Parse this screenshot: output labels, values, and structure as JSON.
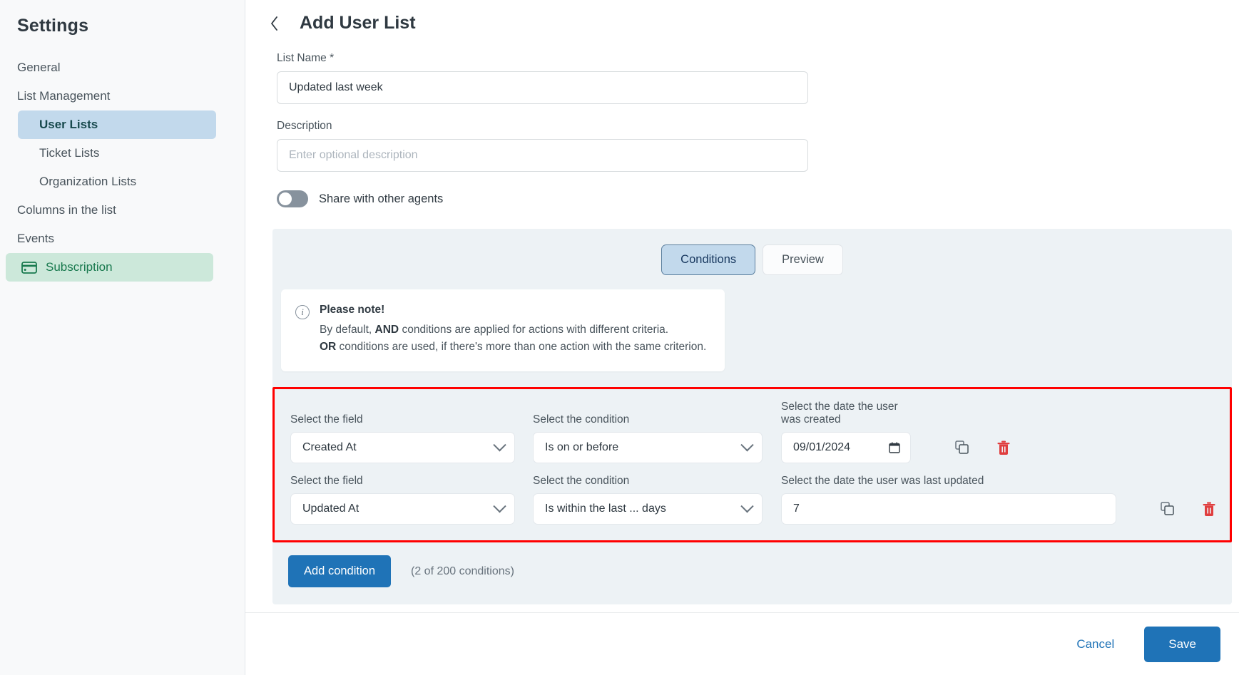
{
  "sidebar": {
    "title": "Settings",
    "items": [
      {
        "label": "General",
        "level": "top"
      },
      {
        "label": "List Management",
        "level": "top"
      },
      {
        "label": "User Lists",
        "level": "sub",
        "state": "active-blue"
      },
      {
        "label": "Ticket Lists",
        "level": "sub"
      },
      {
        "label": "Organization Lists",
        "level": "sub"
      },
      {
        "label": "Columns in the list",
        "level": "top"
      },
      {
        "label": "Events",
        "level": "top"
      },
      {
        "label": "Subscription",
        "level": "top",
        "state": "active-green",
        "icon": "credit-card-icon"
      }
    ]
  },
  "header": {
    "back_icon": "chevron-left-icon",
    "title": "Add User List"
  },
  "form": {
    "list_name_label": "List Name *",
    "list_name_value": "Updated last week",
    "description_label": "Description",
    "description_value": "",
    "description_placeholder": "Enter optional description",
    "share_toggle_label": "Share with other agents",
    "share_toggle_state": "off"
  },
  "panel": {
    "tabs": [
      {
        "label": "Conditions",
        "active": true
      },
      {
        "label": "Preview",
        "active": false
      }
    ],
    "note": {
      "icon": "info-icon",
      "title": "Please note!",
      "line1_pre": "By default, ",
      "line1_bold": "AND",
      "line1_post": " conditions are applied for actions with different criteria.",
      "line2_bold": "OR",
      "line2_post": " conditions are used, if there's more than one action with the same criterion."
    },
    "conditions": [
      {
        "field_label": "Select the field",
        "field_value": "Created At",
        "condition_label": "Select the condition",
        "condition_value": "Is on or before",
        "value_label": "Select the date the user was created",
        "value": "09/01/2024",
        "value_type": "date",
        "copy_icon": "copy-icon",
        "delete_icon": "trash-icon"
      },
      {
        "field_label": "Select the field",
        "field_value": "Updated At",
        "condition_label": "Select the condition",
        "condition_value": "Is within the last ... days",
        "value_label": "Select the date the user was last updated",
        "value": "7",
        "value_type": "number",
        "copy_icon": "copy-icon",
        "delete_icon": "trash-icon"
      }
    ],
    "add_condition_label": "Add condition",
    "condition_count": "(2 of 200 conditions)"
  },
  "footer": {
    "cancel_label": "Cancel",
    "save_label": "Save"
  },
  "colors": {
    "primary": "#1f73b7",
    "highlight_border": "#ff0000",
    "active_nav": "#c2d9ec",
    "subscription_bg": "#cce8da",
    "subscription_text": "#18794e",
    "danger": "#e03e3e"
  }
}
